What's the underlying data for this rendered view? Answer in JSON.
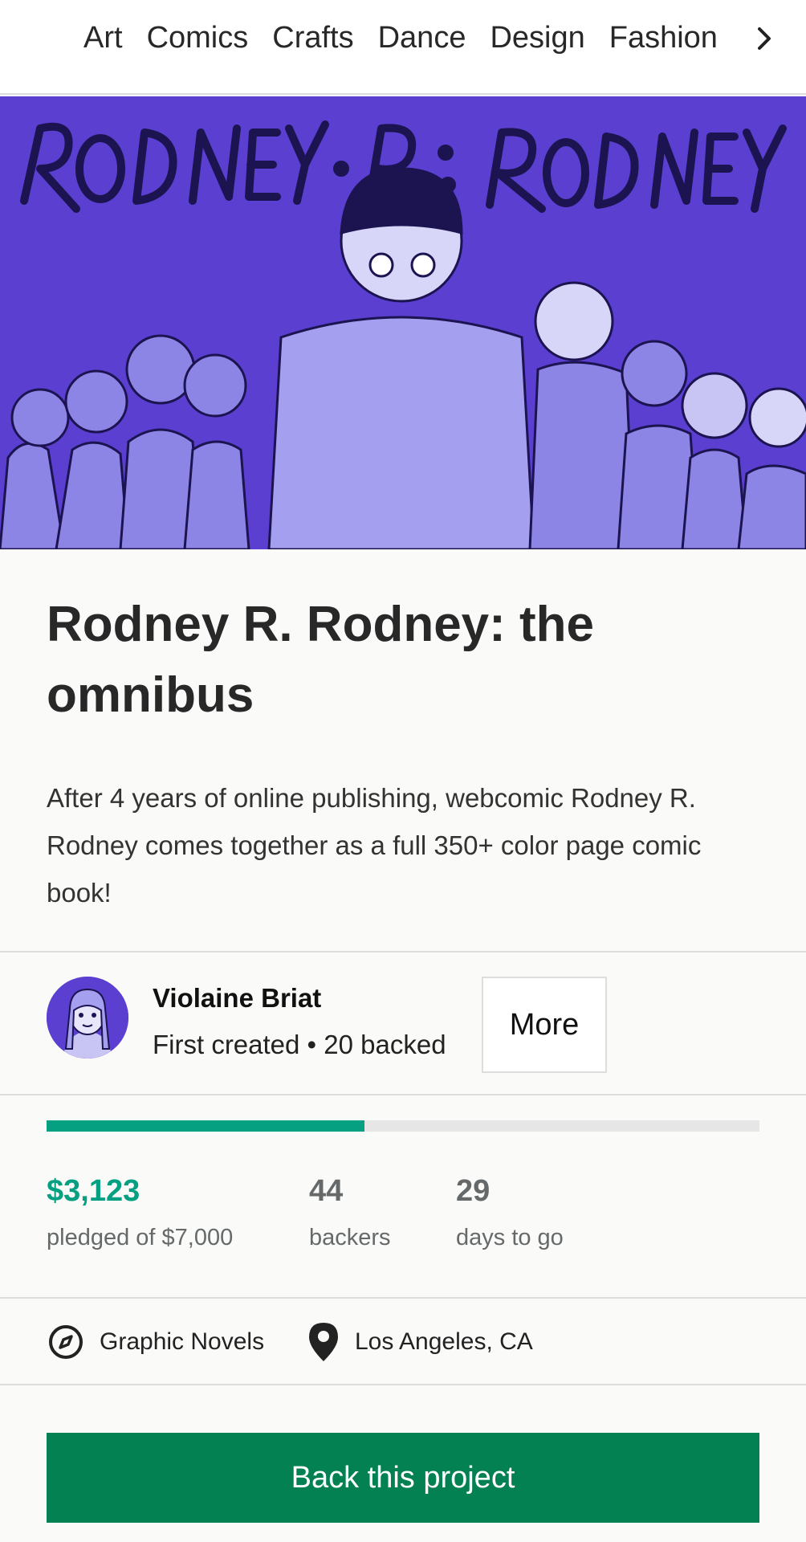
{
  "nav": {
    "categories": [
      "Art",
      "Comics",
      "Crafts",
      "Dance",
      "Design",
      "Fashion"
    ],
    "next_icon": "chevron-right-icon"
  },
  "hero": {
    "image": "rodney-r-rodney-cover-illustration",
    "lettering": "RODNEY · R · RODNEY",
    "background_color": "#5a3fd0"
  },
  "project": {
    "title": "Rodney R. Rodney: the omnibus",
    "blurb": "After 4 years of online publishing, webcomic Rodney R. Rodney comes together as a full 350+ color page comic book!"
  },
  "creator": {
    "name": "Violaine Briat",
    "meta": "First created • 20 backed",
    "more_label": "More"
  },
  "funding": {
    "progress_fraction": 0.446,
    "pledged": "$3,123",
    "pledged_label": "pledged of $7,000",
    "backers": "44",
    "backers_label": "backers",
    "days": "29",
    "days_label": "days to go",
    "accent_color": "#05a081"
  },
  "meta": {
    "category": "Graphic Novels",
    "category_icon": "compass-icon",
    "location": "Los Angeles, CA",
    "location_icon": "map-pin-icon"
  },
  "cta": {
    "label": "Back this project",
    "color": "#038152"
  }
}
